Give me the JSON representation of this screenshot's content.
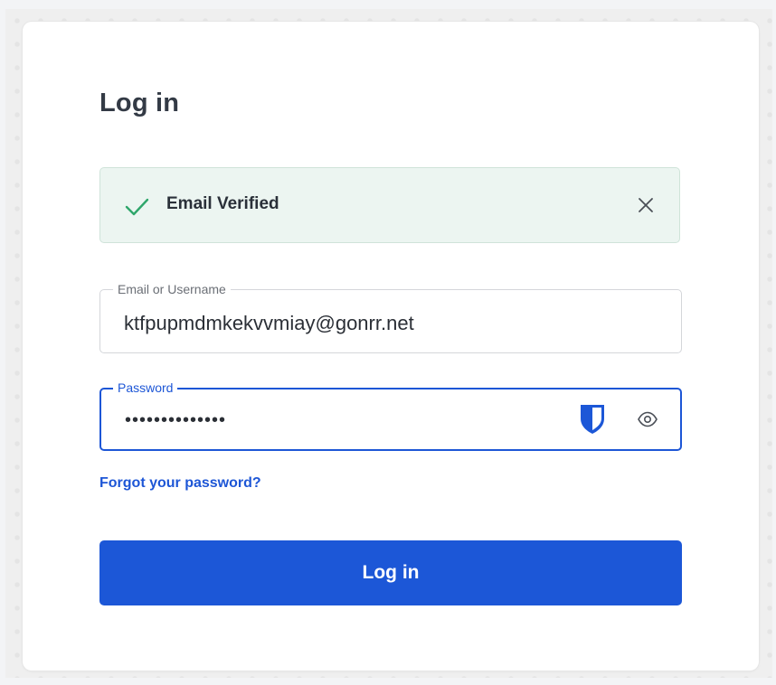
{
  "page": {
    "title": "Log in"
  },
  "alert": {
    "message": "Email Verified",
    "icon": "check-icon",
    "close_icon": "close-icon",
    "color": "#2fa66b"
  },
  "email_field": {
    "label": "Email or Username",
    "value": "ktfpupmdmkekvvmiay@gonrr.net"
  },
  "password_field": {
    "label": "Password",
    "value": "••••••••••••••",
    "shield_icon": "bitwarden-shield-icon",
    "toggle_icon": "eye-icon"
  },
  "links": {
    "forgot_password": "Forgot your password?"
  },
  "actions": {
    "login_label": "Log in"
  },
  "colors": {
    "accent": "#1c57d7",
    "alert_bg": "#ecf5f1",
    "title": "#333a45"
  }
}
